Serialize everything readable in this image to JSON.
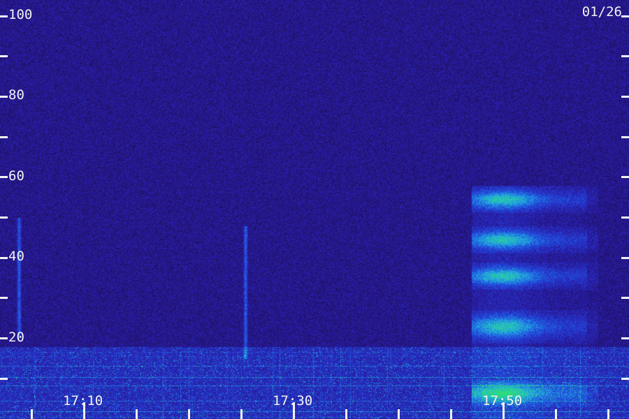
{
  "chart_data": {
    "type": "heatmap",
    "date_label": "01/26",
    "y_ticks": [
      100,
      80,
      60,
      40,
      20
    ],
    "y_range": [
      0,
      104
    ],
    "y_minor_ticks": [
      10,
      30,
      50,
      70,
      90
    ],
    "x_labels": [
      "17:10",
      "17:30",
      "17:50"
    ],
    "x_label_minutes": [
      10,
      30,
      50
    ],
    "x_range_minutes": [
      2,
      62
    ],
    "x_minor_tick_minutes": [
      5,
      15,
      20,
      25,
      35,
      40,
      45,
      55,
      60
    ],
    "colormap": [
      "#1e0f5a",
      "#2a1fb0",
      "#2050e0",
      "#22b0e0",
      "#30e070"
    ],
    "features": [
      {
        "kind": "burst",
        "time_min": [
          47,
          59
        ],
        "freq_ranges": [
          [
            53,
            56
          ],
          [
            43,
            46
          ],
          [
            34,
            37
          ],
          [
            21,
            25
          ],
          [
            5,
            8
          ]
        ]
      },
      {
        "kind": "streak",
        "time_min": 3.8,
        "freq": [
          20,
          50
        ]
      },
      {
        "kind": "streak",
        "time_min": 25.4,
        "freq": [
          15,
          48
        ]
      },
      {
        "kind": "noise_band",
        "freq": [
          0,
          18
        ]
      }
    ]
  }
}
